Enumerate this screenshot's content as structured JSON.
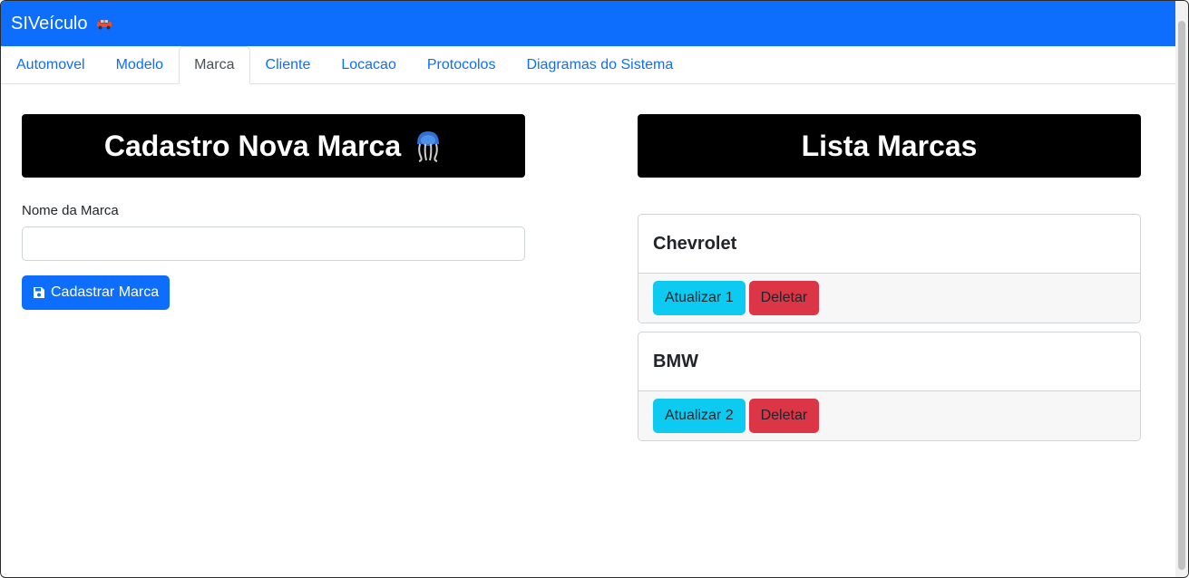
{
  "navbar": {
    "brand": "SIVeículo",
    "brand_icon": "car-icon"
  },
  "tabs": [
    {
      "label": "Automovel"
    },
    {
      "label": "Modelo"
    },
    {
      "label": "Marca"
    },
    {
      "label": "Cliente"
    },
    {
      "label": "Locacao"
    },
    {
      "label": "Protocolos"
    },
    {
      "label": "Diagramas do Sistema"
    }
  ],
  "active_tab": "Marca",
  "form": {
    "title": "Cadastro Nova Marca",
    "title_icon": "jellyfish-icon",
    "field_label": "Nome da Marca",
    "field_value": "",
    "submit_label": "Cadastrar Marca",
    "submit_icon": "save-icon"
  },
  "list": {
    "title": "Lista Marcas",
    "items": [
      {
        "name": "Chevrolet",
        "update_label": "Atualizar 1",
        "delete_label": "Deletar"
      },
      {
        "name": "BMW",
        "update_label": "Atualizar 2",
        "delete_label": "Deletar"
      }
    ]
  },
  "colors": {
    "primary": "#0d6efd",
    "info": "#0dcaf0",
    "danger": "#dc3545",
    "title_bg": "#000000"
  }
}
